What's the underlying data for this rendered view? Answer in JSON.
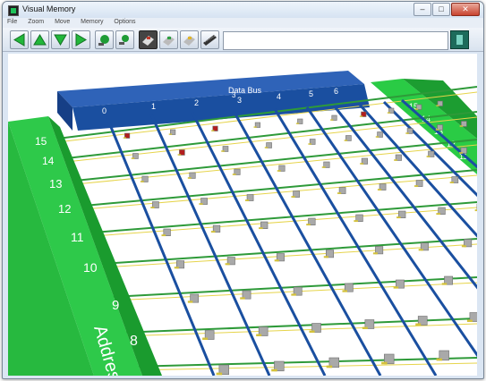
{
  "window": {
    "title": "Visual Memory"
  },
  "menu": [
    "File",
    "Zoom",
    "Move",
    "Memory",
    "Options"
  ],
  "toolbar": {
    "buttons": [
      "arrow-left-icon",
      "arrow-up-icon",
      "arrow-down-icon",
      "arrow-right-icon",
      "green-ball-icon",
      "green-ball-small-icon",
      "chip-red-icon",
      "chip-green-icon",
      "chip-yellow-icon",
      "chip-strip-icon"
    ],
    "input_value": "",
    "go_icon": "go-icon"
  },
  "scene": {
    "data_bus_label": "Data Bus",
    "data_bus_ticks": [
      "0",
      "1",
      "2",
      "3",
      "3",
      "4",
      "5",
      "6"
    ],
    "address_label": "Address",
    "address_ticks": [
      "15",
      "14",
      "13",
      "12",
      "11",
      "10",
      "9",
      "8"
    ],
    "right_ticks": [
      "15",
      "14",
      "13",
      "12",
      "11"
    ],
    "colors": {
      "bus_blue": "#1a4fa0",
      "address_green": "#22c33a",
      "wire_green": "#2e9a39",
      "cell_grey": "#a9a9a9",
      "cell_red": "#b21e1e"
    }
  }
}
